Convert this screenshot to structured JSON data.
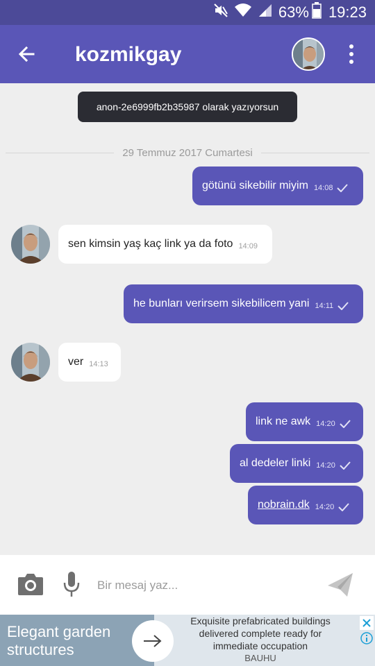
{
  "status_bar": {
    "battery": "63%",
    "time": "19:23",
    "icons": [
      "mute-icon",
      "wifi-icon",
      "signal-icon",
      "battery-icon"
    ]
  },
  "header": {
    "title": "kozmikgay",
    "back_icon": "arrow-back-icon",
    "more_icon": "more-vert-icon"
  },
  "toast": "anon-2e6999fb2b35987 olarak yazıyorsun",
  "date_separator": "29 Temmuz 2017 Cumartesi",
  "messages": [
    {
      "direction": "out",
      "text": "götünü sikebilir miyim",
      "time": "14:08"
    },
    {
      "direction": "in",
      "text": "sen kimsin yaş kaç link ya da foto",
      "time": "14:09"
    },
    {
      "direction": "out",
      "text": "he bunları verirsem sikebilicem yani",
      "time": "14:11"
    },
    {
      "direction": "in",
      "text": "ver",
      "time": "14:13"
    },
    {
      "direction": "out",
      "text": "link ne awk",
      "time": "14:20"
    },
    {
      "direction": "out",
      "text": "al dedeler linki",
      "time": "14:20"
    },
    {
      "direction": "out",
      "text": "nobrain.dk",
      "time": "14:20",
      "is_link": true
    }
  ],
  "composer": {
    "placeholder": "Bir mesaj yaz...",
    "value": ""
  },
  "ad": {
    "headline": "Elegant garden structures",
    "body": "Exquisite prefabricated buildings delivered complete ready for immediate occupation",
    "brand": "BAUHU"
  },
  "colors": {
    "status_bar": "#4c4a98",
    "app_bar": "#5a56b7",
    "outgoing_bubble": "#5a56b7",
    "incoming_bubble": "#ffffff",
    "background": "#eeeeee"
  }
}
